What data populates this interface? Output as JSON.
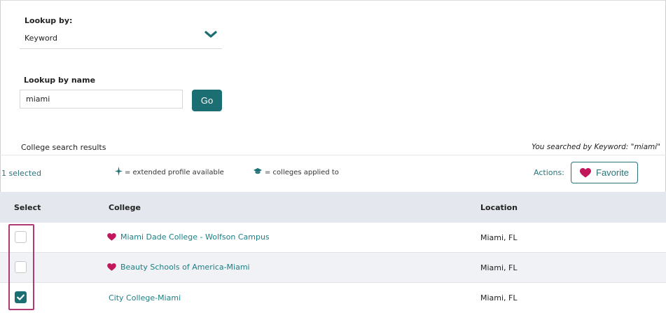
{
  "lookup": {
    "label": "Lookup by:",
    "selected_value": "Keyword",
    "name_label": "Lookup by name",
    "name_value": "miami",
    "go_label": "Go"
  },
  "results": {
    "title": "College search results",
    "searched_text": "You searched by Keyword: \"miami\"",
    "selected_count": "1 selected",
    "legend_extended": "= extended profile available",
    "legend_applied": "= colleges applied to",
    "actions_label": "Actions:",
    "favorite_label": "Favorite"
  },
  "table": {
    "headers": {
      "select": "Select",
      "college": "College",
      "location": "Location"
    },
    "rows": [
      {
        "name": "Miami Dade College - Wolfson Campus",
        "location": "Miami, FL",
        "favorite": true,
        "checked": false
      },
      {
        "name": "Beauty Schools of America-Miami",
        "location": "Miami, FL",
        "favorite": true,
        "checked": false
      },
      {
        "name": "City College-Miami",
        "location": "Miami, FL",
        "favorite": false,
        "checked": true
      }
    ]
  },
  "colors": {
    "accent": "#1b6f73",
    "heart": "#c2185b",
    "annotation": "#b03a73",
    "arrow": "#7a1446"
  },
  "icons": {
    "dropdown": "chevron-down-icon",
    "extended_profile": "sparkle-icon",
    "applied": "graduation-cap-icon",
    "favorite": "heart-icon",
    "checkbox_checked": "checkmark-icon",
    "annotation_arrow": "arrow-up-icon"
  }
}
